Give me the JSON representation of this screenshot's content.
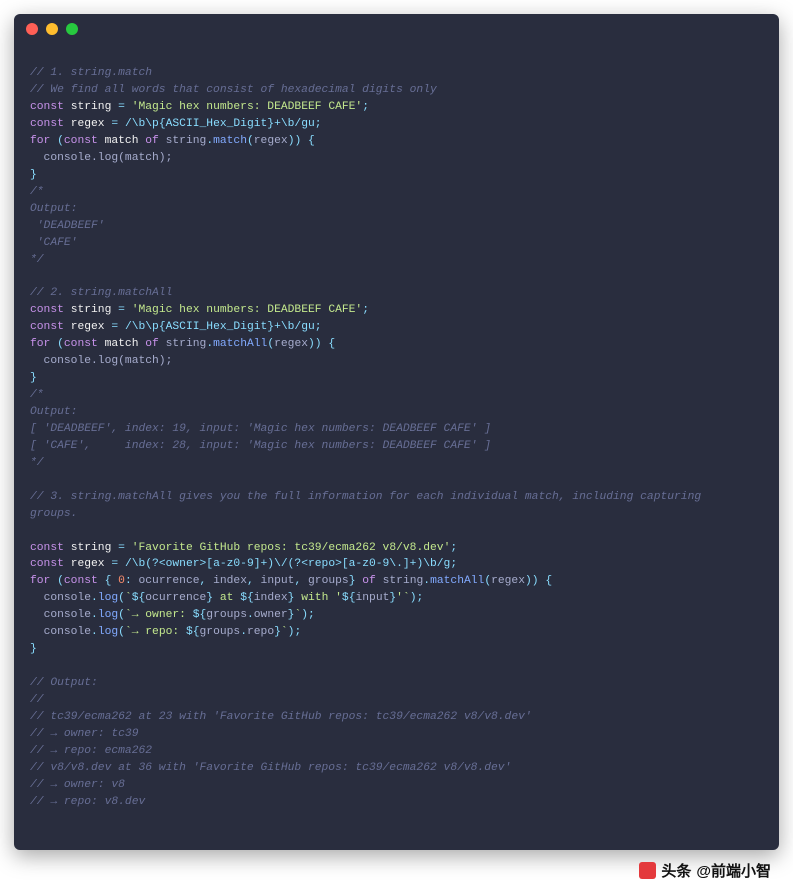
{
  "code": {
    "s1_c1": "// 1. string.match",
    "s1_c2": "// We find all words that consist of hexadecimal digits only",
    "kw_const": "const",
    "kw_for": "for",
    "kw_of": "of",
    "nm_string": "string",
    "nm_regex": "regex",
    "nm_match": "match",
    "nm_console": "console",
    "fn_log": "log",
    "fn_match": "match",
    "fn_matchAll": "matchAll",
    "eq": " = ",
    "semi": ";",
    "lp": "(",
    "rp": ")",
    "lb": "{",
    "rb": "}",
    "dot": ".",
    "str_hex": "'Magic hex numbers: DEADBEEF CAFE'",
    "rx_hex": "/\\b\\p{ASCII_Hex_Digit}+\\b/gu",
    "indent_log_match": "  console.log(match);",
    "s1_o1": "/*",
    "s1_o2": "Output:",
    "s1_o3": " 'DEADBEEF'",
    "s1_o4": " 'CAFE'",
    "s1_o5": "*/",
    "s2_c1": "// 2. string.matchAll",
    "s2_o3": "[ 'DEADBEEF', index: 19, input: 'Magic hex numbers: DEADBEEF CAFE' ]",
    "s2_o4": "[ 'CAFE',     index: 28, input: 'Magic hex numbers: DEADBEEF CAFE' ]",
    "s3_c1": "// 3. string.matchAll gives you the full information for each individual match, including capturing",
    "s3_c2": "groups.",
    "str_repos": "'Favorite GitHub repos: tc39/ecma262 v8/v8.dev'",
    "rx_repos": "/\\b(?<owner>[a-z0-9]+)\\/(?<repo>[a-z0-9\\.]+)\\b/g",
    "destruct_open": " { ",
    "num_zero": "0",
    "colon_sp": ": ",
    "nm_ocurrence": "ocurrence",
    "com_sp": ", ",
    "nm_index": "index",
    "nm_input": "input",
    "nm_groups": "groups",
    "destruct_close": "} ",
    "tpl_open": "`",
    "tpl_p1a": "${",
    "tpl_p1b": "ocurrence",
    "tpl_p1c": "}",
    "tpl_at": " at ",
    "tpl_p2b": "index",
    "tpl_with": " with '",
    "tpl_p3b": "input",
    "tpl_endq": "'",
    "tpl_owner_pre": "→ owner: ",
    "nm_owner": "owner",
    "tpl_repo_pre": "→ repo: ",
    "nm_repo": "repo",
    "s3_oc1": "// Output:",
    "s3_oc2": "//",
    "s3_oc3": "// tc39/ecma262 at 23 with 'Favorite GitHub repos: tc39/ecma262 v8/v8.dev'",
    "s3_oc4": "// → owner: tc39",
    "s3_oc5": "// → repo: ecma262",
    "s3_oc6": "// v8/v8.dev at 36 with 'Favorite GitHub repos: tc39/ecma262 v8/v8.dev'",
    "s3_oc7": "// → owner: v8",
    "s3_oc8": "// → repo: v8.dev"
  },
  "watermark": {
    "prefix": "头条",
    "handle": "@前端小智"
  }
}
